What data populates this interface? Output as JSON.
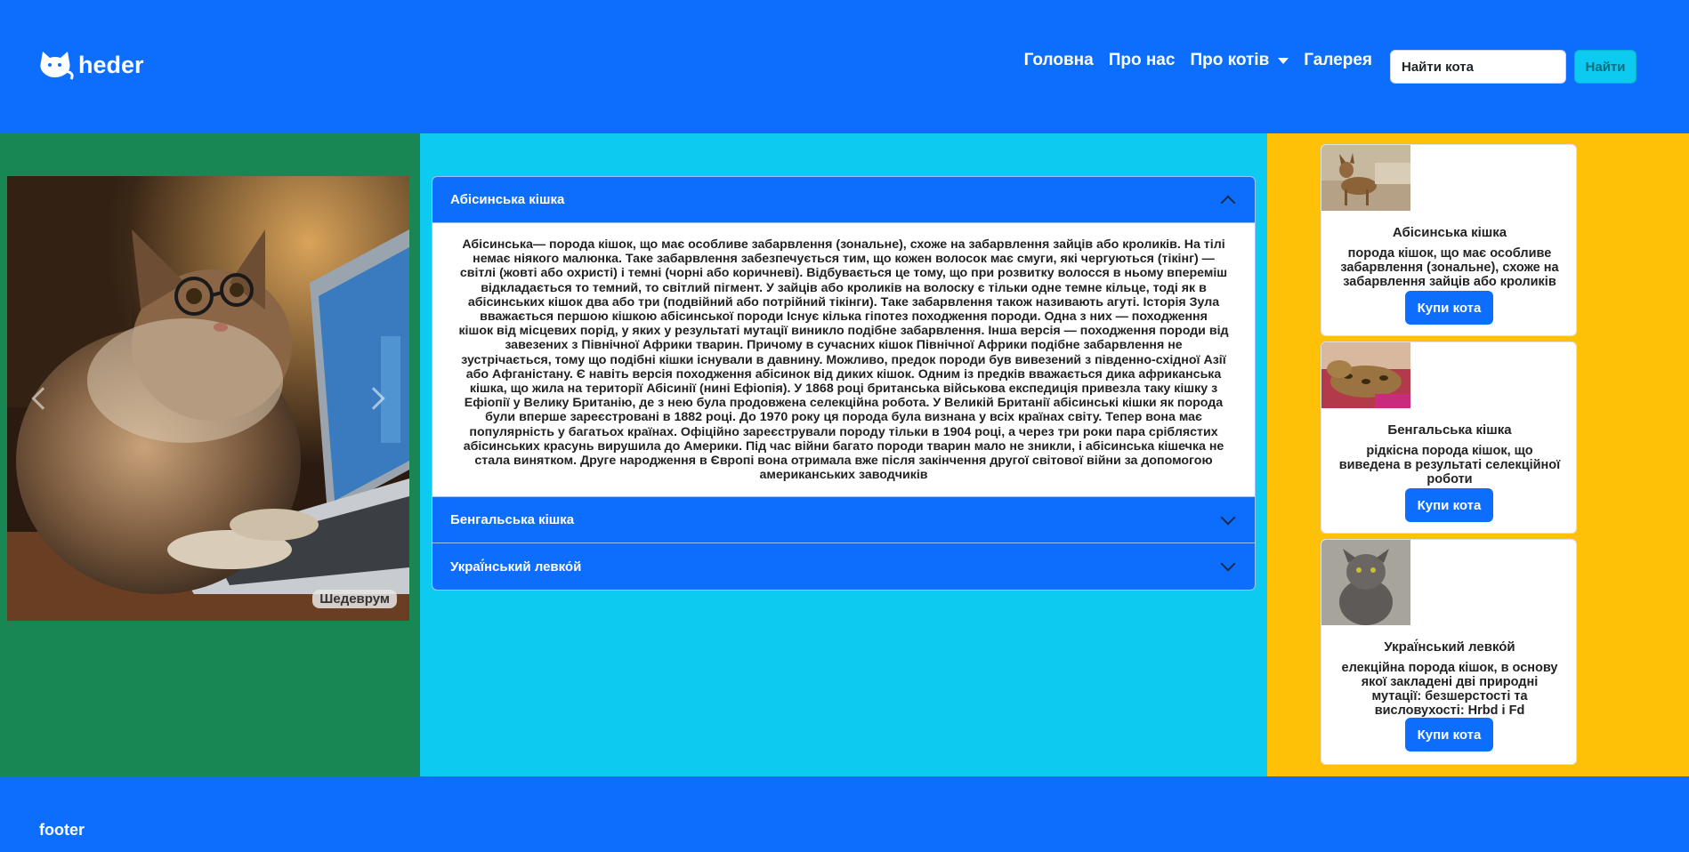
{
  "header": {
    "brand": "heder",
    "nav": {
      "home": "Головна",
      "about": "Про нас",
      "cats": "Про котів",
      "gallery": "Галерея"
    },
    "search": {
      "placeholder": "Найти кота",
      "button": "Найти"
    }
  },
  "colors": {
    "primary": "#0d6efd",
    "success": "#198754",
    "info": "#0dcaf0",
    "warning": "#ffc107"
  },
  "carousel": {
    "watermark": "Шедеврум",
    "prev_icon": "chevron-left-icon",
    "next_icon": "chevron-right-icon"
  },
  "accordion": {
    "items": [
      {
        "title": "Абісинська кішка",
        "expanded": true,
        "body": [
          "Абісинська— порода кішок, що має особливе забарвлення (зональне), схоже на забарвлення зайців або кроликів. На тілі",
          "немає ніякого малюнка. Таке забарвлення забезпечується тим, що кожен волосок має смуги, які чергуються (тікінг) —",
          "світлі (жовті або охристі) і темні (чорні або коричневі). Відбувається це тому, що при розвитку волосся в ньому впереміш",
          "відкладається то темний, то світлий пігмент. У зайців або кроликів на волоску є тільки одне темне кільце, тоді як в",
          "абісинських кішок два або три (подвійний або потрійний тікінги). Таке забарвлення також називають агуті. Історія Зула",
          "вважається першою кішкою абісинської породи Існує кілька гіпотез походження породи. Одна з них — походження",
          "кішок від місцевих порід, у яких у результаті мутації виникло подібне забарвлення. Інша версія — походження породи від",
          "завезених з Північної Африки тварин. Причому в сучасних кішок Північної Африки подібне забарвлення не",
          "зустрічається, тому що подібні кішки існували в давнину. Можливо, предок породи був вивезений з південно-східної Азії",
          "або Афганістану. Є навіть версія походження абісинок від диких кішок. Одним із предків вважається дика африканська",
          "кішка, що жила на території Абісинії (нині Ефіопія). У 1868 році британська військова експедиція привезла таку кішку з",
          "Ефіопії у Велику Британію, де з нею була продовжена селекційна робота. У Великій Британії абісинські кішки як порода",
          "були вперше зареєстровані в 1882 році. До 1970 року ця порода була визнана у всіх країнах світу. Тепер вона має",
          "популярність у багатьох країнах. Офіційно зареєстрували породу тільки в 1904 році, а через три роки пара сріблястих",
          "абісинських красунь вирушила до Америки. Під час війни багато породи тварин мало не зникли, і абісинська кішечка не",
          "стала винятком. Друге народження в Європі вона отримала вже після закінчення другої світової війни за допомогою",
          "американських заводчиків"
        ]
      },
      {
        "title": "Бенгальська кішка",
        "expanded": false
      },
      {
        "title": "Украї́нський левко́й",
        "expanded": false
      }
    ]
  },
  "cards": [
    {
      "title": "Абісинська кішка",
      "text": [
        "порода кішок, що має особливе",
        "забарвлення (зональне), схоже на",
        "забарвлення зайців або кроликів"
      ],
      "button": "Купи кота"
    },
    {
      "title": "Бенгальська кішка",
      "text": [
        "рідкісна порода кішок, що",
        "виведена в результаті селекційної",
        "роботи"
      ],
      "button": "Купи кота"
    },
    {
      "title": "Украї́нський левко́й",
      "text": [
        "елекційна порода кішок, в основу",
        "якої закладені дві природні",
        "мутації: безшерстості та",
        "висловухості: Hrbd і Fd"
      ],
      "button": "Купи кота"
    }
  ],
  "footer": {
    "text": "footer"
  }
}
